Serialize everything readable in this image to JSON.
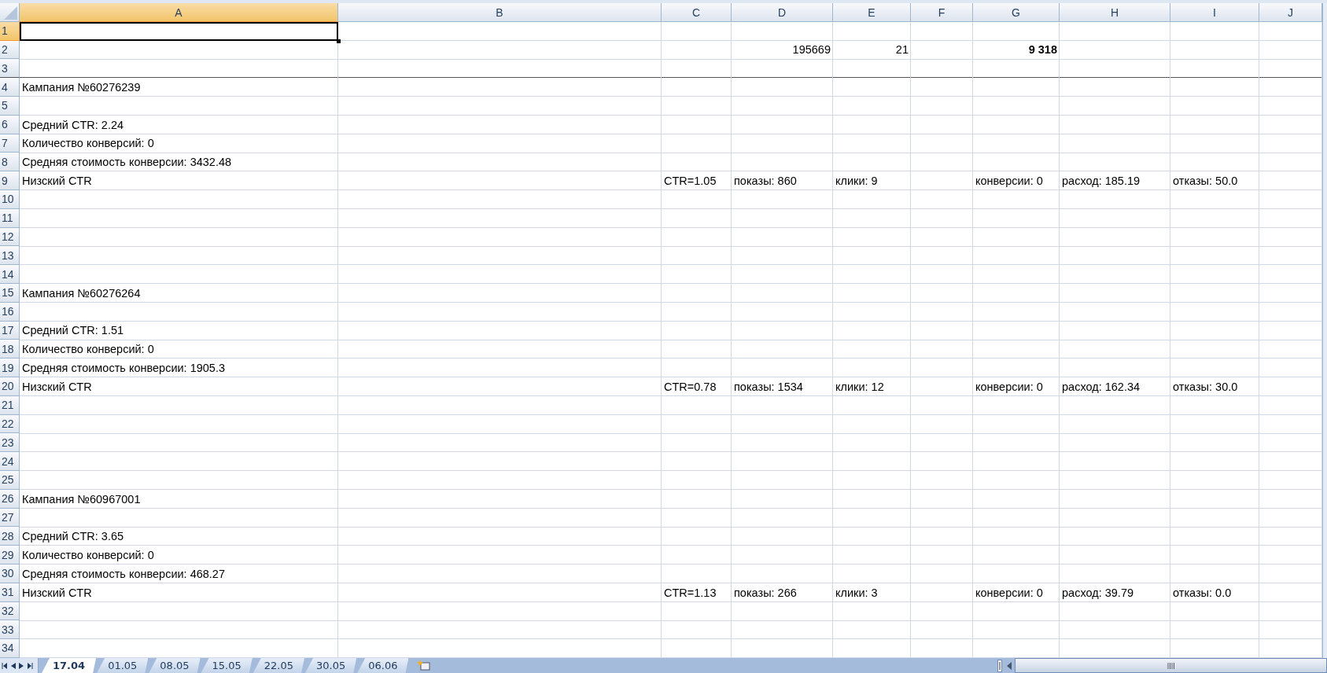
{
  "columns": [
    {
      "label": "A",
      "selected": true
    },
    {
      "label": "B",
      "selected": false
    },
    {
      "label": "C",
      "selected": false
    },
    {
      "label": "D",
      "selected": false
    },
    {
      "label": "E",
      "selected": false
    },
    {
      "label": "F",
      "selected": false
    },
    {
      "label": "G",
      "selected": false
    },
    {
      "label": "H",
      "selected": false
    },
    {
      "label": "I",
      "selected": false
    },
    {
      "label": "J",
      "selected": false
    }
  ],
  "frozen_rows": [
    {
      "label": "1",
      "selected": true,
      "cells": {}
    },
    {
      "label": "2",
      "selected": false,
      "cells": {
        "D": {
          "text": "195669",
          "kind": "number",
          "bold": false
        },
        "E": {
          "text": "21",
          "kind": "number",
          "bold": false
        },
        "G": {
          "text": "9 318",
          "kind": "number",
          "bold": true
        }
      }
    },
    {
      "label": "3",
      "selected": false,
      "cells": {}
    }
  ],
  "rows": [
    {
      "label": "4",
      "selected": false,
      "cells": {
        "A": {
          "text": "Кампания №60276239",
          "kind": "text",
          "bold": false
        }
      }
    },
    {
      "label": "5",
      "selected": false,
      "cells": {}
    },
    {
      "label": "6",
      "selected": false,
      "cells": {
        "A": {
          "text": "Средний CTR: 2.24",
          "kind": "text",
          "bold": false
        }
      }
    },
    {
      "label": "7",
      "selected": false,
      "cells": {
        "A": {
          "text": "Количество конверсий: 0",
          "kind": "text",
          "bold": false
        }
      }
    },
    {
      "label": "8",
      "selected": false,
      "cells": {
        "A": {
          "text": "Средняя стоимость конверсии: 3432.48",
          "kind": "text",
          "bold": false
        }
      }
    },
    {
      "label": "9",
      "selected": false,
      "cells": {
        "A": {
          "text": "Низский CTR",
          "kind": "text",
          "bold": false
        },
        "C": {
          "text": "CTR=1.05",
          "kind": "text",
          "bold": false
        },
        "D": {
          "text": "показы: 860",
          "kind": "text",
          "bold": false
        },
        "E": {
          "text": "клики: 9",
          "kind": "text",
          "bold": false
        },
        "G": {
          "text": "конверсии: 0",
          "kind": "text",
          "bold": false
        },
        "H": {
          "text": "расход: 185.19",
          "kind": "text",
          "bold": false
        },
        "I": {
          "text": "отказы: 50.0",
          "kind": "text",
          "bold": false
        }
      }
    },
    {
      "label": "10",
      "selected": false,
      "cells": {}
    },
    {
      "label": "11",
      "selected": false,
      "cells": {}
    },
    {
      "label": "12",
      "selected": false,
      "cells": {}
    },
    {
      "label": "13",
      "selected": false,
      "cells": {}
    },
    {
      "label": "14",
      "selected": false,
      "cells": {}
    },
    {
      "label": "15",
      "selected": false,
      "cells": {
        "A": {
          "text": "Кампания №60276264",
          "kind": "text",
          "bold": false
        }
      }
    },
    {
      "label": "16",
      "selected": false,
      "cells": {}
    },
    {
      "label": "17",
      "selected": false,
      "cells": {
        "A": {
          "text": "Средний CTR: 1.51",
          "kind": "text",
          "bold": false
        }
      }
    },
    {
      "label": "18",
      "selected": false,
      "cells": {
        "A": {
          "text": "Количество конверсий: 0",
          "kind": "text",
          "bold": false
        }
      }
    },
    {
      "label": "19",
      "selected": false,
      "cells": {
        "A": {
          "text": "Средняя стоимость конверсии: 1905.3",
          "kind": "text",
          "bold": false
        }
      }
    },
    {
      "label": "20",
      "selected": false,
      "cells": {
        "A": {
          "text": "Низский CTR",
          "kind": "text",
          "bold": false
        },
        "C": {
          "text": "CTR=0.78",
          "kind": "text",
          "bold": false
        },
        "D": {
          "text": "показы: 1534",
          "kind": "text",
          "bold": false
        },
        "E": {
          "text": "клики: 12",
          "kind": "text",
          "bold": false
        },
        "G": {
          "text": "конверсии: 0",
          "kind": "text",
          "bold": false
        },
        "H": {
          "text": "расход: 162.34",
          "kind": "text",
          "bold": false
        },
        "I": {
          "text": "отказы: 30.0",
          "kind": "text",
          "bold": false
        }
      }
    },
    {
      "label": "21",
      "selected": false,
      "cells": {}
    },
    {
      "label": "22",
      "selected": false,
      "cells": {}
    },
    {
      "label": "23",
      "selected": false,
      "cells": {}
    },
    {
      "label": "24",
      "selected": false,
      "cells": {}
    },
    {
      "label": "25",
      "selected": false,
      "cells": {}
    },
    {
      "label": "26",
      "selected": false,
      "cells": {
        "A": {
          "text": "Кампания №60967001",
          "kind": "text",
          "bold": false
        }
      }
    },
    {
      "label": "27",
      "selected": false,
      "cells": {}
    },
    {
      "label": "28",
      "selected": false,
      "cells": {
        "A": {
          "text": "Средний CTR: 3.65",
          "kind": "text",
          "bold": false
        }
      }
    },
    {
      "label": "29",
      "selected": false,
      "cells": {
        "A": {
          "text": "Количество конверсий: 0",
          "kind": "text",
          "bold": false
        }
      }
    },
    {
      "label": "30",
      "selected": false,
      "cells": {
        "A": {
          "text": "Средняя стоимость конверсии: 468.27",
          "kind": "text",
          "bold": false
        }
      }
    },
    {
      "label": "31",
      "selected": false,
      "cells": {
        "A": {
          "text": "Низский CTR",
          "kind": "text",
          "bold": false
        },
        "C": {
          "text": "CTR=1.13",
          "kind": "text",
          "bold": false
        },
        "D": {
          "text": "показы: 266",
          "kind": "text",
          "bold": false
        },
        "E": {
          "text": "клики: 3",
          "kind": "text",
          "bold": false
        },
        "G": {
          "text": "конверсии: 0",
          "kind": "text",
          "bold": false
        },
        "H": {
          "text": "расход: 39.79",
          "kind": "text",
          "bold": false
        },
        "I": {
          "text": "отказы: 0.0",
          "kind": "text",
          "bold": false
        }
      }
    },
    {
      "label": "32",
      "selected": false,
      "cells": {}
    },
    {
      "label": "33",
      "selected": false,
      "cells": {}
    },
    {
      "label": "34",
      "selected": false,
      "cells": {}
    }
  ],
  "sheet_tabs": [
    {
      "label": "17.04",
      "selected": true
    },
    {
      "label": "01.05",
      "selected": false
    },
    {
      "label": "08.05",
      "selected": false
    },
    {
      "label": "15.05",
      "selected": false
    },
    {
      "label": "22.05",
      "selected": false
    },
    {
      "label": "30.05",
      "selected": false
    },
    {
      "label": "06.06",
      "selected": false
    }
  ]
}
